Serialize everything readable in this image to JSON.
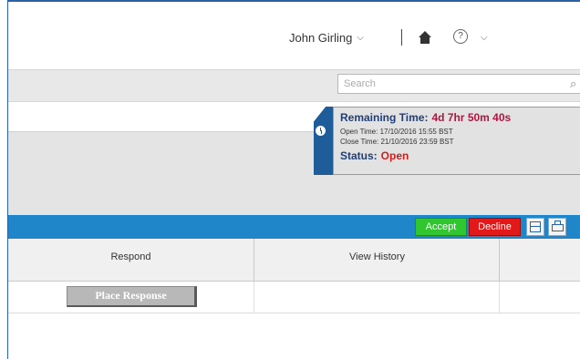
{
  "header": {
    "user_name": "John Girling",
    "user_chevron": "⌵",
    "separator": "|",
    "help_glyph": "?",
    "menu_chevron": "⌵"
  },
  "search": {
    "placeholder": "Search"
  },
  "timer": {
    "remaining_label": "Remaining Time:",
    "remaining_value": "4d 7hr 50m 40s",
    "open_time": "Open Time: 17/10/2016 15:55 BST",
    "close_time": "Close Time: 21/10/2016 23:59 BST",
    "status_label": "Status:",
    "status_value": "Open"
  },
  "toolbar": {
    "accept_label": "Accept",
    "decline_label": "Decline"
  },
  "table": {
    "columns": [
      "Respond",
      "View History",
      ""
    ],
    "rows": [
      {
        "action_label": "Place Response"
      }
    ]
  },
  "colors": {
    "frame_blue": "#2a62a8",
    "toolbar_blue": "#1f87c9",
    "accept_green": "#2fc62f",
    "decline_red": "#e31818",
    "remaining_red": "#b0163f",
    "status_red": "#d21c1c"
  },
  "icons": [
    "home-icon",
    "help-icon",
    "search-icon",
    "clock-icon",
    "columns-icon",
    "print-icon"
  ]
}
